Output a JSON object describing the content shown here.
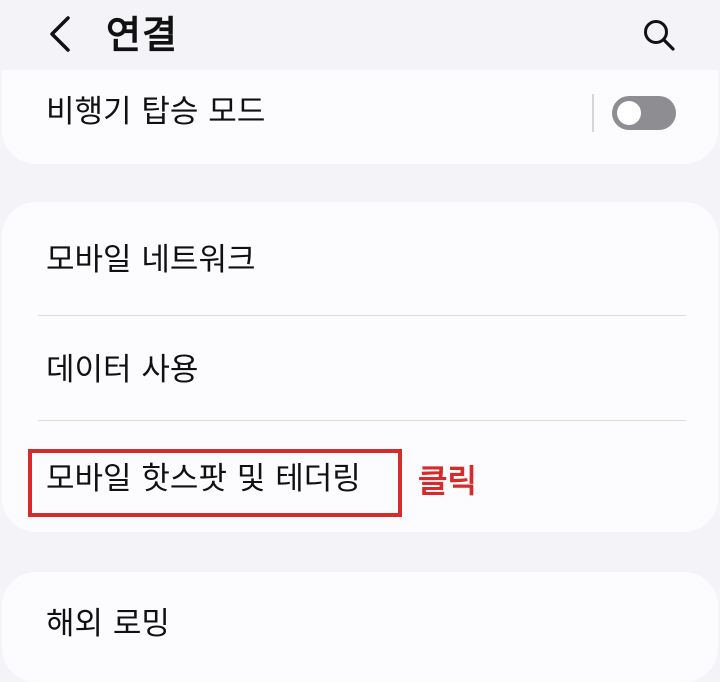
{
  "header": {
    "title": "연결",
    "back_icon": "chevron-left-icon",
    "search_icon": "search-icon"
  },
  "airplane_mode": {
    "label": "비행기 탑승 모드",
    "toggle_state": "off"
  },
  "network_group": {
    "items": [
      {
        "label": "모바일 네트워크"
      },
      {
        "label": "데이터 사용"
      },
      {
        "label": "모바일 핫스팟 및 테더링"
      }
    ]
  },
  "roaming": {
    "label": "해외 로밍"
  },
  "annotation": {
    "text": "클릭",
    "color": "#d52b2b"
  },
  "colors": {
    "background": "#f4f3f7",
    "card": "#fcfcfe",
    "toggle_off": "#8e8e92"
  }
}
